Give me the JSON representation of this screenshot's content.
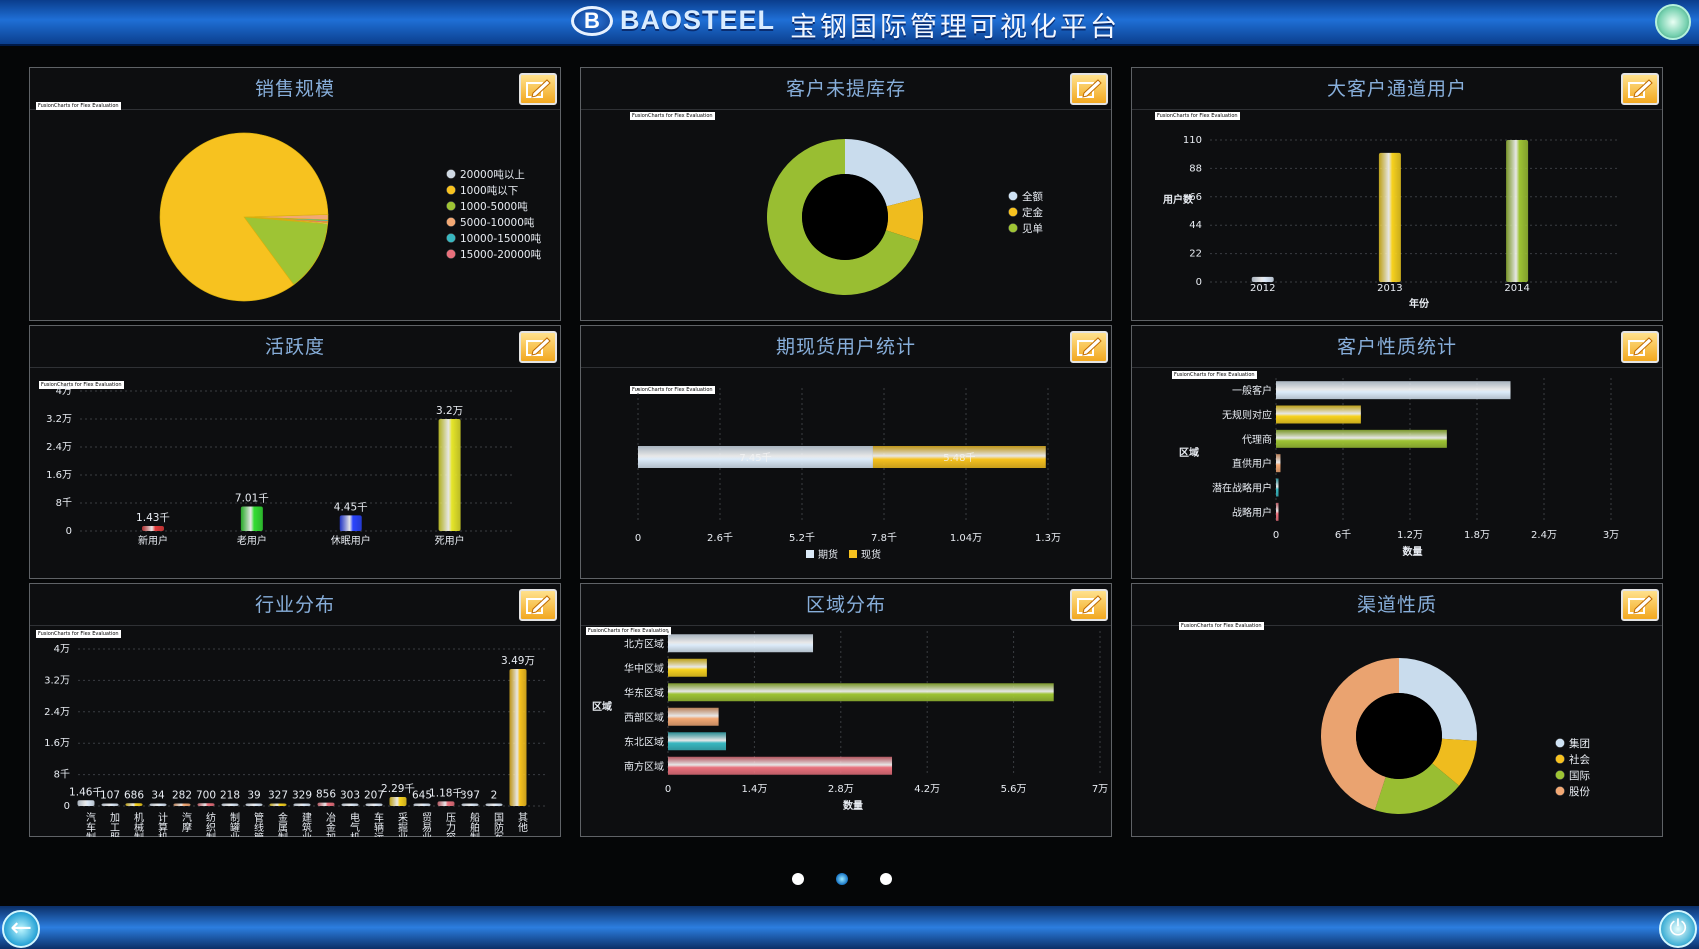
{
  "header": {
    "brand": "BAOSTEEL",
    "title": "宝钢国际管理可视化平台"
  },
  "eval_watermark": "FusionCharts for Flex Evaluation",
  "pager": {
    "count": 3,
    "active": 1
  },
  "colors": {
    "yellow": "#f7c21f",
    "green": "#9ec434",
    "lightblue": "#cfe7fb",
    "orange": "#f2a874",
    "teal": "#38b7c0",
    "red": "#e9707c",
    "blue": "#2a44ff"
  },
  "chart_data": [
    {
      "id": "sales-scale",
      "title": "销售规模",
      "type": "pie",
      "slices": [
        {
          "label": "20000吨以上",
          "value": 0.2,
          "color": "#cfd8e3"
        },
        {
          "label": "1000吨以下",
          "value": 84.6,
          "color": "#f7c21f"
        },
        {
          "label": "1000-5000吨",
          "value": 13.6,
          "color": "#9ec434"
        },
        {
          "label": "5000-10000吨",
          "value": 1.0,
          "color": "#f2a874"
        },
        {
          "label": "10000-15000吨",
          "value": 0.3,
          "color": "#38b7c0"
        },
        {
          "label": "15000-20000吨",
          "value": 0.3,
          "color": "#e9707c"
        }
      ]
    },
    {
      "id": "customer-stock",
      "title": "客户未提库存",
      "type": "pie",
      "donut": true,
      "slices": [
        {
          "label": "全额",
          "value": 21,
          "color": "#cfe3f5"
        },
        {
          "label": "定金",
          "value": 9,
          "color": "#f7c21f"
        },
        {
          "label": "见单",
          "value": 70,
          "color": "#9ec434"
        }
      ]
    },
    {
      "id": "key-account-users",
      "title": "大客户通道用户",
      "type": "bar",
      "categories": [
        "2012",
        "2013",
        "2014"
      ],
      "values": [
        4,
        100,
        110
      ],
      "colors": [
        "#dce9f8",
        "#f7d21f",
        "#9ec434"
      ],
      "ylim": [
        0,
        110
      ],
      "yticks": [
        "0",
        "22",
        "44",
        "66",
        "88",
        "110"
      ],
      "xlabel": "年份",
      "ylabel": "用户数"
    },
    {
      "id": "activity",
      "title": "活跃度",
      "type": "bar",
      "categories": [
        "新用户",
        "老用户",
        "休眠用户",
        "死用户"
      ],
      "values": [
        1430,
        7010,
        4450,
        32000
      ],
      "value_labels": [
        "1.43千",
        "7.01千",
        "4.45千",
        "3.2万"
      ],
      "colors": [
        "#e23b3b",
        "#33dd33",
        "#2a44ff",
        "#e6e62a"
      ],
      "ylim": [
        0,
        40000
      ],
      "yticks": [
        "0",
        "8千",
        "1.6万",
        "2.4万",
        "3.2万",
        "4万"
      ]
    },
    {
      "id": "futures-spot",
      "title": "期现货用户统计",
      "type": "bar",
      "orientation": "stacked-horizontal",
      "series": [
        {
          "name": "期货",
          "values": [
            7450
          ],
          "label": "7.45千",
          "color": "#dcebf9"
        },
        {
          "name": "现货",
          "values": [
            5480
          ],
          "label": "5.48千",
          "color": "#f7c21f"
        }
      ],
      "xlim": [
        0,
        13000
      ],
      "xticks": [
        "0",
        "2.6千",
        "5.2千",
        "7.8千",
        "1.04万",
        "1.3万"
      ]
    },
    {
      "id": "customer-type",
      "title": "客户性质统计",
      "type": "bar",
      "orientation": "horizontal",
      "categories": [
        "一般客户",
        "无规则对应",
        "代理商",
        "直供用户",
        "潜在战略用户",
        "战略用户"
      ],
      "values": [
        21000,
        7600,
        15300,
        400,
        50,
        150
      ],
      "colors": [
        "#dcebf9",
        "#f7d21f",
        "#9ec434",
        "#f2a874",
        "#38b7c0",
        "#e9707c"
      ],
      "xlim": [
        0,
        30000
      ],
      "xticks": [
        "0",
        "6千",
        "1.2万",
        "1.8万",
        "2.4万",
        "3万"
      ],
      "xlabel": "数量",
      "ylabel": "区域"
    },
    {
      "id": "industry",
      "title": "行业分布",
      "type": "bar",
      "categories": [
        "汽车制造业",
        "加工服务业",
        "机械制造业",
        "计算机制造",
        "汽摩",
        "纺织制造业",
        "制罐业",
        "管线管",
        "金属制品业",
        "建筑业",
        "冶金加工业",
        "电气机...",
        "车辆运...",
        "采掘业",
        "贸易业",
        "压力容器业",
        "船舶制造业",
        "国防军工",
        "其他"
      ],
      "values": [
        1460,
        107,
        686,
        34,
        282,
        700,
        218,
        39,
        327,
        329,
        856,
        303,
        207,
        2290,
        645,
        1180,
        397,
        2,
        34900
      ],
      "value_labels": [
        "1.46千",
        "107",
        "686",
        "34",
        "282",
        "700",
        "218",
        "39",
        "327",
        "329",
        "856",
        "303",
        "207",
        "2.29千",
        "645",
        "1.18千",
        "397",
        "2",
        "3.49万"
      ],
      "ylim": [
        0,
        40000
      ],
      "yticks": [
        "0",
        "8千",
        "1.6万",
        "2.4万",
        "3.2万",
        "4万"
      ]
    },
    {
      "id": "region",
      "title": "区域分布",
      "type": "bar",
      "orientation": "horizontal",
      "categories": [
        "北方区域",
        "华中区域",
        "华东区域",
        "西部区域",
        "东北区域",
        "南方区域"
      ],
      "values": [
        23500,
        6300,
        62500,
        8200,
        9400,
        36300
      ],
      "colors": [
        "#dcebf9",
        "#f7d21f",
        "#9ec434",
        "#f2a874",
        "#38b7c0",
        "#e9707c"
      ],
      "xlim": [
        0,
        70000
      ],
      "xticks": [
        "0",
        "1.4万",
        "2.8万",
        "4.2万",
        "5.6万",
        "7万"
      ],
      "xlabel": "数量",
      "ylabel": "区域"
    },
    {
      "id": "channel",
      "title": "渠道性质",
      "type": "pie",
      "donut": true,
      "slices": [
        {
          "label": "集团",
          "value": 26,
          "color": "#cfe3f5"
        },
        {
          "label": "社会",
          "value": 10,
          "color": "#f7c21f"
        },
        {
          "label": "国际",
          "value": 19,
          "color": "#9ec434"
        },
        {
          "label": "股份",
          "value": 45,
          "color": "#f2a874"
        }
      ]
    }
  ]
}
